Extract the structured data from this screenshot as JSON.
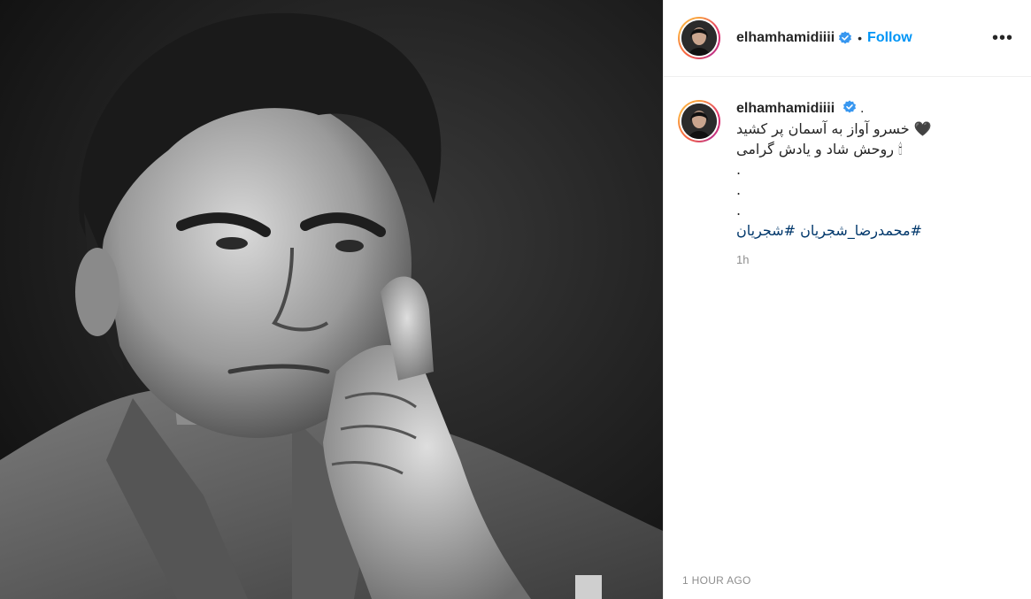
{
  "post": {
    "username": "elhamhamidiiii",
    "follow_label": "Follow",
    "dot": "•",
    "more_label": "•••",
    "caption": {
      "suffix": ".",
      "lines": [
        "🖤 خسرو آواز به آسمان پر کشید",
        "🕯 روحش شاد و یادش گرامی",
        ".",
        ".",
        "."
      ],
      "hashtags": "#محمدرضا_شجریان #شجریان"
    },
    "relative_time": "1h",
    "timestamp": "1 HOUR AGO"
  },
  "colors": {
    "link_blue": "#0095f6",
    "hashtag": "#00376b",
    "muted": "#8e8e8e"
  },
  "icons": [
    "verified-badge-icon",
    "more-options-icon"
  ]
}
